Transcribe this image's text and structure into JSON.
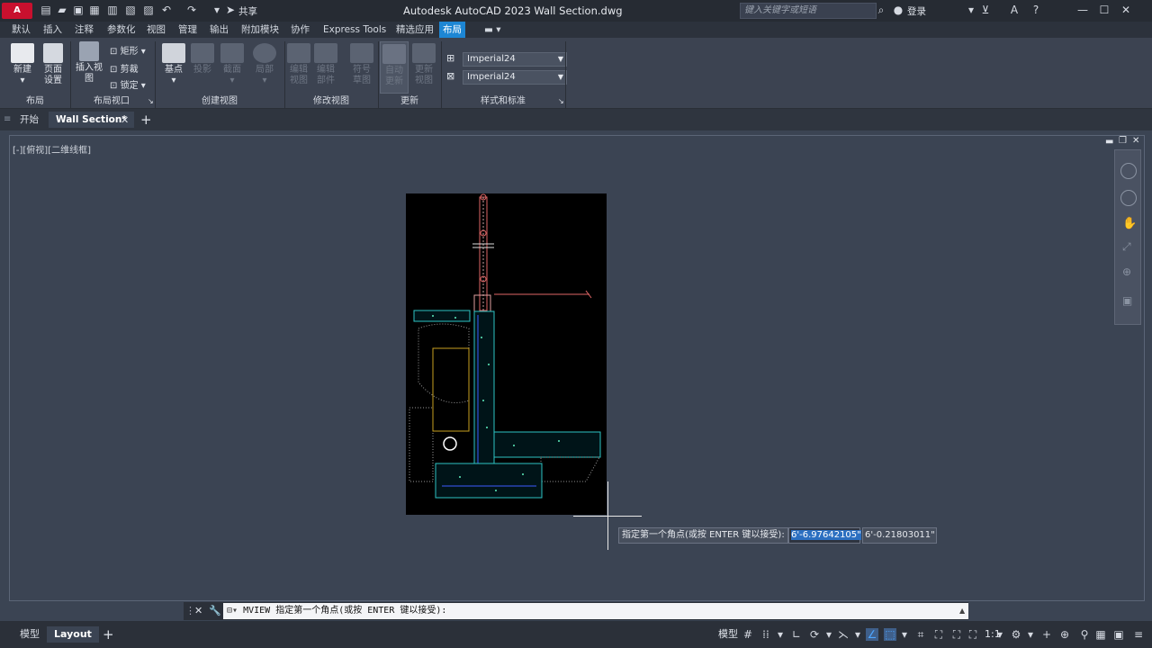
{
  "app": {
    "logo": "A CAD",
    "title": "Autodesk AutoCAD 2023    Wall Section.dwg",
    "search_placeholder": "键入关键字或短语",
    "share": "共享",
    "login": "登录"
  },
  "ribbon_tabs": [
    "默认",
    "插入",
    "注释",
    "参数化",
    "视图",
    "管理",
    "输出",
    "附加模块",
    "协作",
    "Express Tools",
    "精选应用",
    "布局"
  ],
  "active_tab": "布局",
  "ribbon": {
    "panel_layout": "布局",
    "btn_new": "新建",
    "btn_page_setup_1": "页面",
    "btn_page_setup_2": "设置",
    "panel_viewport": "布局视口",
    "btn_insert_view": "插入视图",
    "btn_rect": "矩形",
    "btn_clip": "剪裁",
    "btn_lock": "锁定",
    "panel_create_view": "创建视图",
    "btn_base": "基点",
    "btn_projected": "投影",
    "btn_section": "截面",
    "btn_detail": "局部",
    "panel_modify_view": "修改视图",
    "btn_edit_view_1": "编辑",
    "btn_edit_view_2": "视图",
    "btn_edit_comp_1": "编辑",
    "btn_edit_comp_2": "部件",
    "btn_symbol_1": "符号",
    "btn_symbol_2": "草图",
    "panel_update": "更新",
    "btn_auto_update_1": "自动",
    "btn_auto_update_2": "更新",
    "btn_update_view_1": "更新",
    "btn_update_view_2": "视图",
    "panel_styles": "样式和标准",
    "style1": "Imperial24",
    "style2": "Imperial24"
  },
  "doc_tabs": [
    "开始",
    "Wall Section*"
  ],
  "viewport_label": "[-][俯视][二维线框]",
  "tooltip": {
    "prompt": "指定第一个角点(或按 ENTER 键以接受):",
    "coord1": "6'-6.97642105\"",
    "coord2": "6'-0.21803011\""
  },
  "command_line": "MVIEW 指定第一个角点(或按 ENTER 键以接受):",
  "status": {
    "tab_model": "模型",
    "tab_layout": "Layout",
    "model_toggle": "模型",
    "scale": "1:1"
  }
}
